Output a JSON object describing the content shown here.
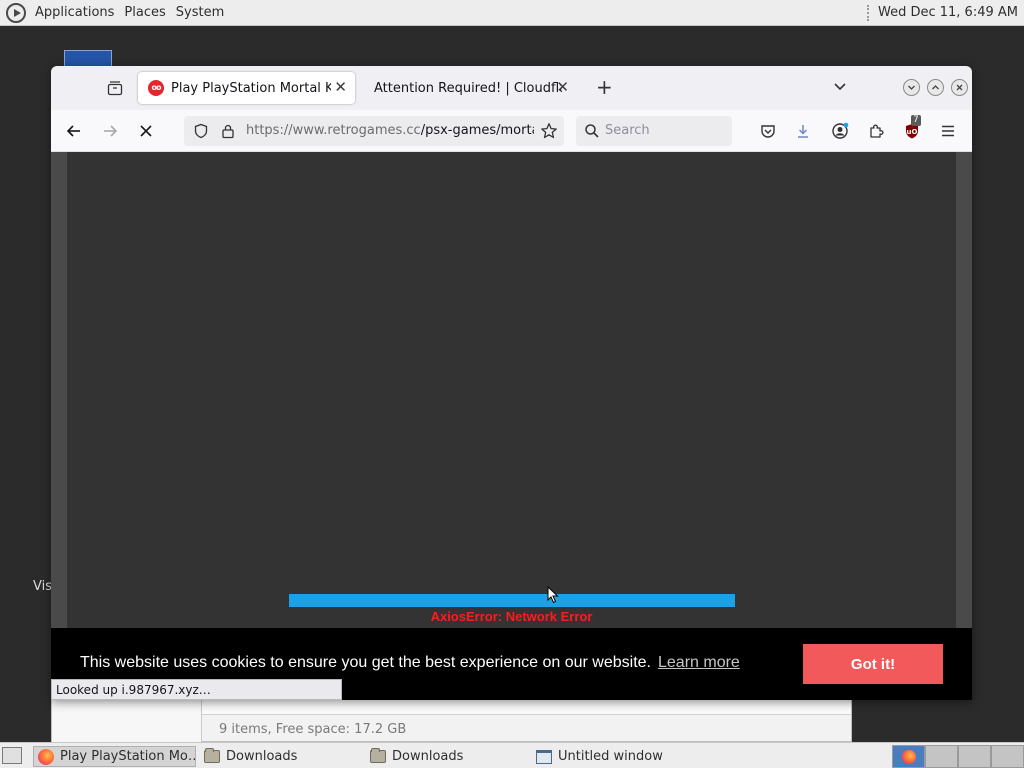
{
  "top_panel": {
    "menus": [
      "Applications",
      "Places",
      "System"
    ],
    "clock": "Wed Dec 11,  6:49 AM"
  },
  "desktop": {
    "partial_label": "Vis"
  },
  "file_manager": {
    "status": "9 items, Free space: 17.2 GB"
  },
  "browser": {
    "tabs": [
      {
        "title": "Play PlayStation Mortal Kombat",
        "active": true
      },
      {
        "title": "Attention Required! | Cloudflare",
        "active": false
      }
    ],
    "url_host": "https://www.retrogames.cc",
    "url_path": "/psx-games/mortal-kombat",
    "search_placeholder": "Search",
    "extension_badge": "7",
    "game": {
      "loading_progress": 1.0,
      "error_text": "AxiosError: Network Error"
    },
    "cookie_banner": {
      "message": "This website uses cookies to ensure you get the best experience on our website.",
      "learn_more": "Learn more",
      "accept": "Got it!"
    },
    "status_text": "Looked up i.987967.xyz…"
  },
  "taskbar": {
    "items": [
      {
        "label": "Play PlayStation Mo…",
        "icon": "firefox-icon",
        "active": true
      },
      {
        "label": "Downloads",
        "icon": "folder-icon",
        "active": false
      },
      {
        "label": "Downloads",
        "icon": "folder-icon",
        "active": false
      },
      {
        "label": "Untitled window",
        "icon": "window-icon",
        "active": false
      }
    ]
  },
  "colors": {
    "progress_bar": "#1ba2e6",
    "error_text": "#ff1b1b",
    "cookie_button": "#f1595a",
    "game_bg": "#333333"
  }
}
